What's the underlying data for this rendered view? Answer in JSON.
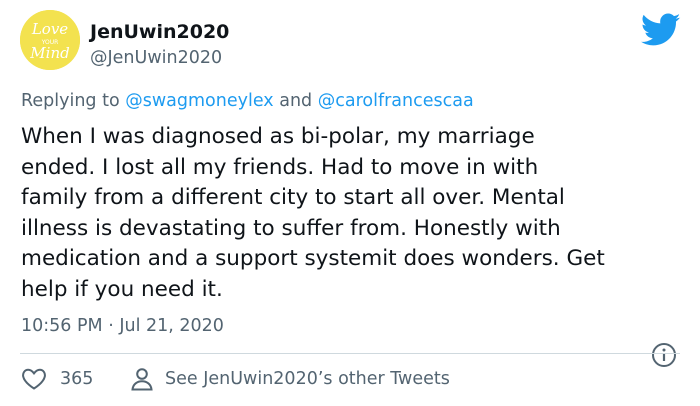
{
  "user": {
    "display_name": "JenUwin2020",
    "handle": "@JenUwin2020",
    "avatar_text_top": "Love",
    "avatar_text_mid": "YOUR",
    "avatar_text_bottom": "Mind"
  },
  "reply": {
    "prefix": "Replying to ",
    "mention_1": "@swagmoneylex",
    "joiner": " and ",
    "mention_2": "@carolfrancescaa"
  },
  "tweet": {
    "text": "When I was diagnosed as bi-polar, my marriage\nended. I lost all my friends. Had to move in with\nfamily from a different city to start all over. Mental\nillness is devastating to suffer from. Honestly with\nmedication and a support systemit does wonders. Get\nhelp if you need it.",
    "timestamp": "10:56 PM · Jul 21, 2020"
  },
  "footer": {
    "like_count": "365",
    "other_tweets_label": "See JenUwin2020’s other Tweets"
  },
  "colors": {
    "accent": "#1d9bf0",
    "secondary_text": "#536471",
    "avatar_bg": "#f3e24f"
  },
  "icons": {
    "brand": "twitter-bird-icon",
    "info": "info-icon",
    "like": "heart-icon",
    "profile": "person-icon"
  }
}
